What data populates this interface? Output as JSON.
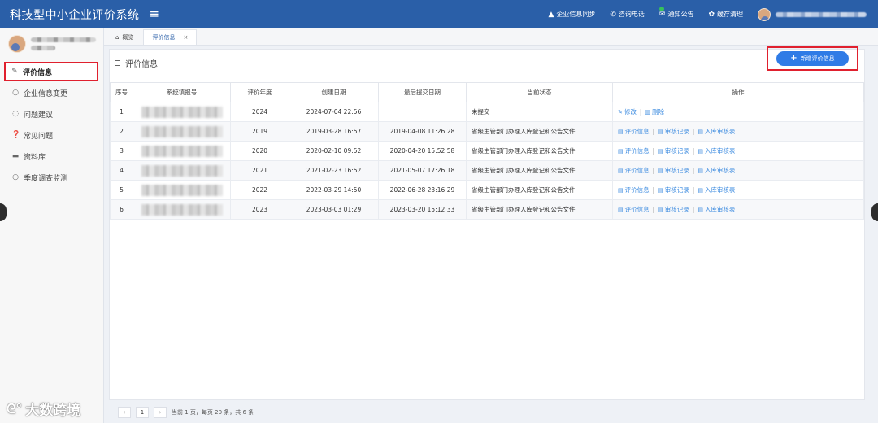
{
  "header": {
    "title": "科技型中小企业评价系统",
    "menu_icon": "hamburger-icon",
    "tools": [
      {
        "label": "企业信息同步",
        "icon": "user-icon"
      },
      {
        "label": "咨询电话",
        "icon": "phone-icon"
      },
      {
        "label": "通知公告",
        "icon": "mail-icon"
      },
      {
        "label": "缓存清理",
        "icon": "gear-icon"
      }
    ]
  },
  "sidebar": {
    "items": [
      {
        "label": "评价信息",
        "icon": "edit-icon"
      },
      {
        "label": "企业信息变更",
        "icon": "circle-icon"
      },
      {
        "label": "问题建议",
        "icon": "comment-icon"
      },
      {
        "label": "常见问题",
        "icon": "question-icon"
      },
      {
        "label": "资料库",
        "icon": "folder-icon"
      },
      {
        "label": "季度调查监测",
        "icon": "circle-icon"
      }
    ]
  },
  "tabs": [
    {
      "label": "概览",
      "icon": "home-icon"
    },
    {
      "label": "评价信息",
      "close": "×"
    }
  ],
  "panel": {
    "title": "评价信息",
    "add_button": "新增评价信息"
  },
  "table": {
    "columns": [
      "序号",
      "系统填报号",
      "评价年度",
      "创建日期",
      "最后提交日期",
      "当前状态",
      "操作"
    ],
    "rows": [
      {
        "idx": "1",
        "year": "2024",
        "created": "2024-07-04 22:56",
        "submitted": "",
        "status": "未提交",
        "ops": [
          "修改",
          "删除"
        ]
      },
      {
        "idx": "2",
        "year": "2019",
        "created": "2019-03-28 16:57",
        "submitted": "2019-04-08 11:26:28",
        "status": "省级主管部门办理入库登记和公告文件",
        "ops": [
          "评价信息",
          "审核记录",
          "入库审核表"
        ]
      },
      {
        "idx": "3",
        "year": "2020",
        "created": "2020-02-10 09:52",
        "submitted": "2020-04-20 15:52:58",
        "status": "省级主管部门办理入库登记和公告文件",
        "ops": [
          "评价信息",
          "审核记录",
          "入库审核表"
        ]
      },
      {
        "idx": "4",
        "year": "2021",
        "created": "2021-02-23 16:52",
        "submitted": "2021-05-07 17:26:18",
        "status": "省级主管部门办理入库登记和公告文件",
        "ops": [
          "评价信息",
          "审核记录",
          "入库审核表"
        ]
      },
      {
        "idx": "5",
        "year": "2022",
        "created": "2022-03-29 14:50",
        "submitted": "2022-06-28 23:16:29",
        "status": "省级主管部门办理入库登记和公告文件",
        "ops": [
          "评价信息",
          "审核记录",
          "入库审核表"
        ]
      },
      {
        "idx": "6",
        "year": "2023",
        "created": "2023-03-03 01:29",
        "submitted": "2023-03-20 15:12:33",
        "status": "省级主管部门办理入库登记和公告文件",
        "ops": [
          "评价信息",
          "审核记录",
          "入库审核表"
        ]
      }
    ]
  },
  "pager": {
    "prev": "‹",
    "page": "1",
    "next": "›",
    "summary": "当前 1 页，每页 20 条，共 6 条"
  },
  "watermark": {
    "text": "大数跨境"
  },
  "colors": {
    "topbar": "#2a5fa8",
    "accent": "#2f7be6",
    "highlight": "#e0202e",
    "link": "#3e8ce0"
  }
}
